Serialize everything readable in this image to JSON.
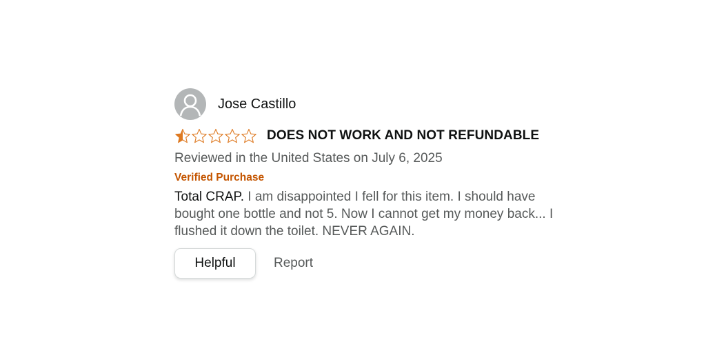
{
  "review": {
    "reviewer_name": "Jose Castillo",
    "avatar_icon": "user-avatar-icon",
    "rating": 1,
    "rating_max": 5,
    "star_fill_color": "#de7921",
    "title": "DOES NOT WORK AND NOT REFUNDABLE",
    "date_line": "Reviewed in the United States on July 6, 2025",
    "verified_label": "Verified Purchase",
    "verified_color": "#c45500",
    "body_lead": "Total CRAP.",
    "body_rest": " I am disappointed I fell for this item. I should have bought one bottle and not 5. Now I cannot get my money back... I flushed it down the toilet. NEVER AGAIN.",
    "helpful_label": "Helpful",
    "report_label": "Report"
  }
}
